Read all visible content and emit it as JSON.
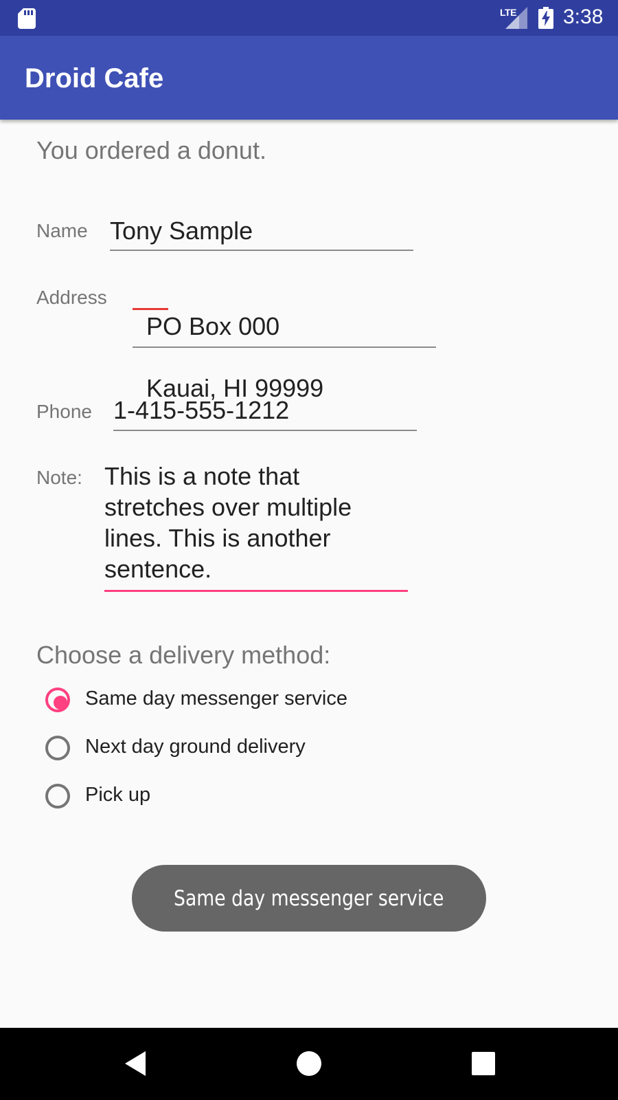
{
  "status_bar": {
    "network_label": "LTE",
    "time": "3:38",
    "icons": [
      "sd-card-icon",
      "signal-icon",
      "battery-charging-icon"
    ]
  },
  "app_bar": {
    "title": "Droid Cafe"
  },
  "order": {
    "message": "You ordered a donut."
  },
  "form": {
    "name": {
      "label": "Name",
      "value": "Tony Sample"
    },
    "address": {
      "label": "Address",
      "value_line1": "PO Box 000",
      "value_line1_rest": " Box 000",
      "value_spell": "PO",
      "value_line2": "Kauai, HI 99999"
    },
    "phone": {
      "label": "Phone",
      "value": "1-415-555-1212"
    },
    "note": {
      "label": "Note:",
      "value": "This is a note that\nstretches over multiple\nlines. This is another\nsentence."
    }
  },
  "delivery": {
    "heading": "Choose a delivery method:",
    "options": [
      {
        "label": "Same day messenger service",
        "selected": true
      },
      {
        "label": "Next day ground delivery",
        "selected": false
      },
      {
        "label": "Pick up",
        "selected": false
      }
    ]
  },
  "toast": {
    "message": "Same day messenger service"
  },
  "nav_bar": {
    "icons": [
      "back-icon",
      "home-icon",
      "recents-icon"
    ]
  },
  "colors": {
    "status_bar": "#303f9f",
    "app_bar": "#3f51b5",
    "accent": "#ff4081",
    "background": "#fafafa",
    "toast": "#666666"
  }
}
